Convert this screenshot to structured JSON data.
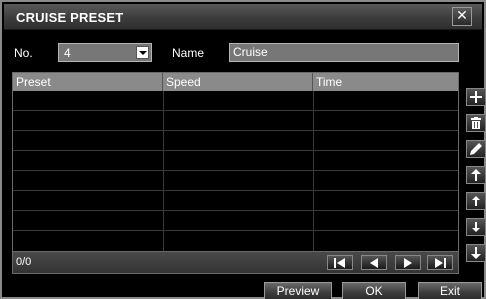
{
  "dialog": {
    "title": "CRUISE PRESET",
    "close_glyph": "✕"
  },
  "form": {
    "no_label": "No.",
    "no_value": "4",
    "name_label": "Name",
    "name_value": "Cruise"
  },
  "table": {
    "columns": [
      "Preset",
      "Speed",
      "Time"
    ],
    "row_count": 8
  },
  "footer": {
    "page_count": "0/0"
  },
  "side_buttons": [
    {
      "name": "add-icon"
    },
    {
      "name": "delete-icon"
    },
    {
      "name": "edit-icon"
    },
    {
      "name": "move-top-icon"
    },
    {
      "name": "move-up-icon"
    },
    {
      "name": "move-down-icon"
    },
    {
      "name": "move-bottom-icon"
    }
  ],
  "buttons": {
    "preview": "Preview",
    "ok": "OK",
    "exit": "Exit"
  }
}
